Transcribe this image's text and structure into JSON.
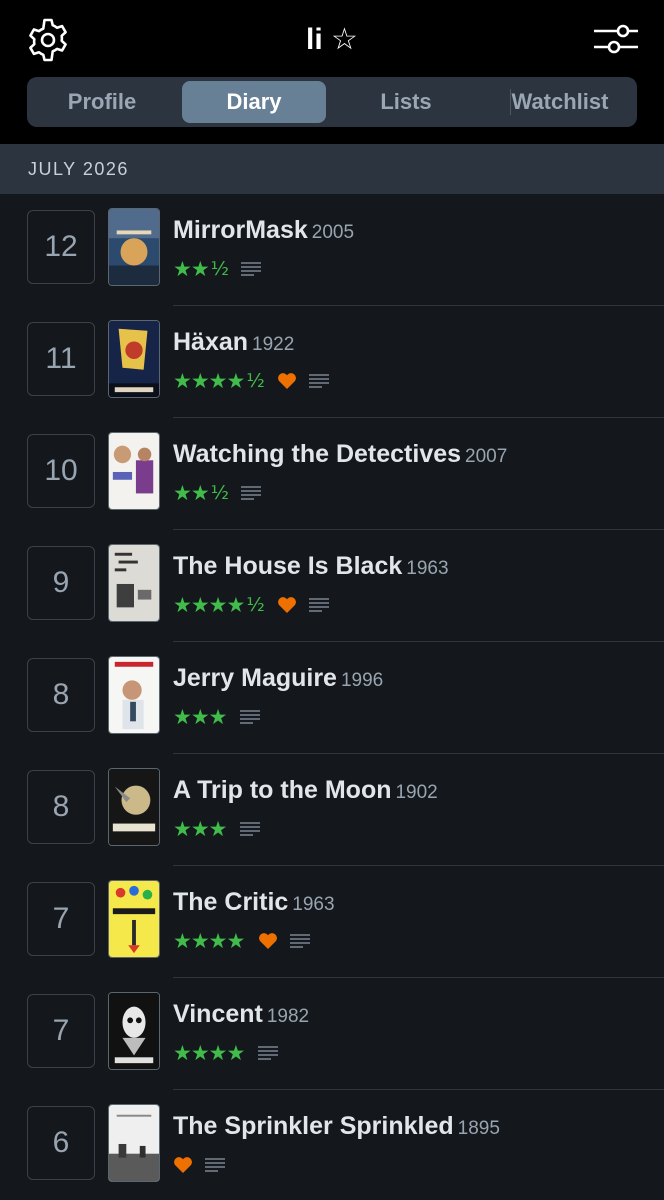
{
  "header": {
    "title": "li",
    "title_star": "☆",
    "settings_icon": "gear-icon",
    "filter_icon": "sliders-icon"
  },
  "tabs": [
    {
      "label": "Profile",
      "active": false
    },
    {
      "label": "Diary",
      "active": true
    },
    {
      "label": "Lists",
      "active": false
    },
    {
      "label": "Watchlist",
      "active": false
    }
  ],
  "month": "JULY 2026",
  "colors": {
    "star_green": "#40bc4a",
    "heart_orange": "#ee7000",
    "tab_active": "#678096"
  },
  "entries": [
    {
      "day": "12",
      "title": "MirrorMask",
      "year": "2005",
      "stars": "★★",
      "half": "½",
      "liked": false,
      "review": true
    },
    {
      "day": "11",
      "title": "Häxan",
      "year": "1922",
      "stars": "★★★★",
      "half": "½",
      "liked": true,
      "review": true
    },
    {
      "day": "10",
      "title": "Watching the Detectives",
      "year": "2007",
      "stars": "★★",
      "half": "½",
      "liked": false,
      "review": true
    },
    {
      "day": "9",
      "title": "The House Is Black",
      "year": "1963",
      "stars": "★★★★",
      "half": "½",
      "liked": true,
      "review": true
    },
    {
      "day": "8",
      "title": "Jerry Maguire",
      "year": "1996",
      "stars": "★★★",
      "half": "",
      "liked": false,
      "review": true
    },
    {
      "day": "8",
      "title": "A Trip to the Moon",
      "year": "1902",
      "stars": "★★★",
      "half": "",
      "liked": false,
      "review": true
    },
    {
      "day": "7",
      "title": "The Critic",
      "year": "1963",
      "stars": "★★★★",
      "half": "",
      "liked": true,
      "review": true
    },
    {
      "day": "7",
      "title": "Vincent",
      "year": "1982",
      "stars": "★★★★",
      "half": "",
      "liked": false,
      "review": true
    },
    {
      "day": "6",
      "title": "The Sprinkler Sprinkled",
      "year": "1895",
      "stars": "",
      "half": "",
      "liked": true,
      "review": true
    }
  ]
}
